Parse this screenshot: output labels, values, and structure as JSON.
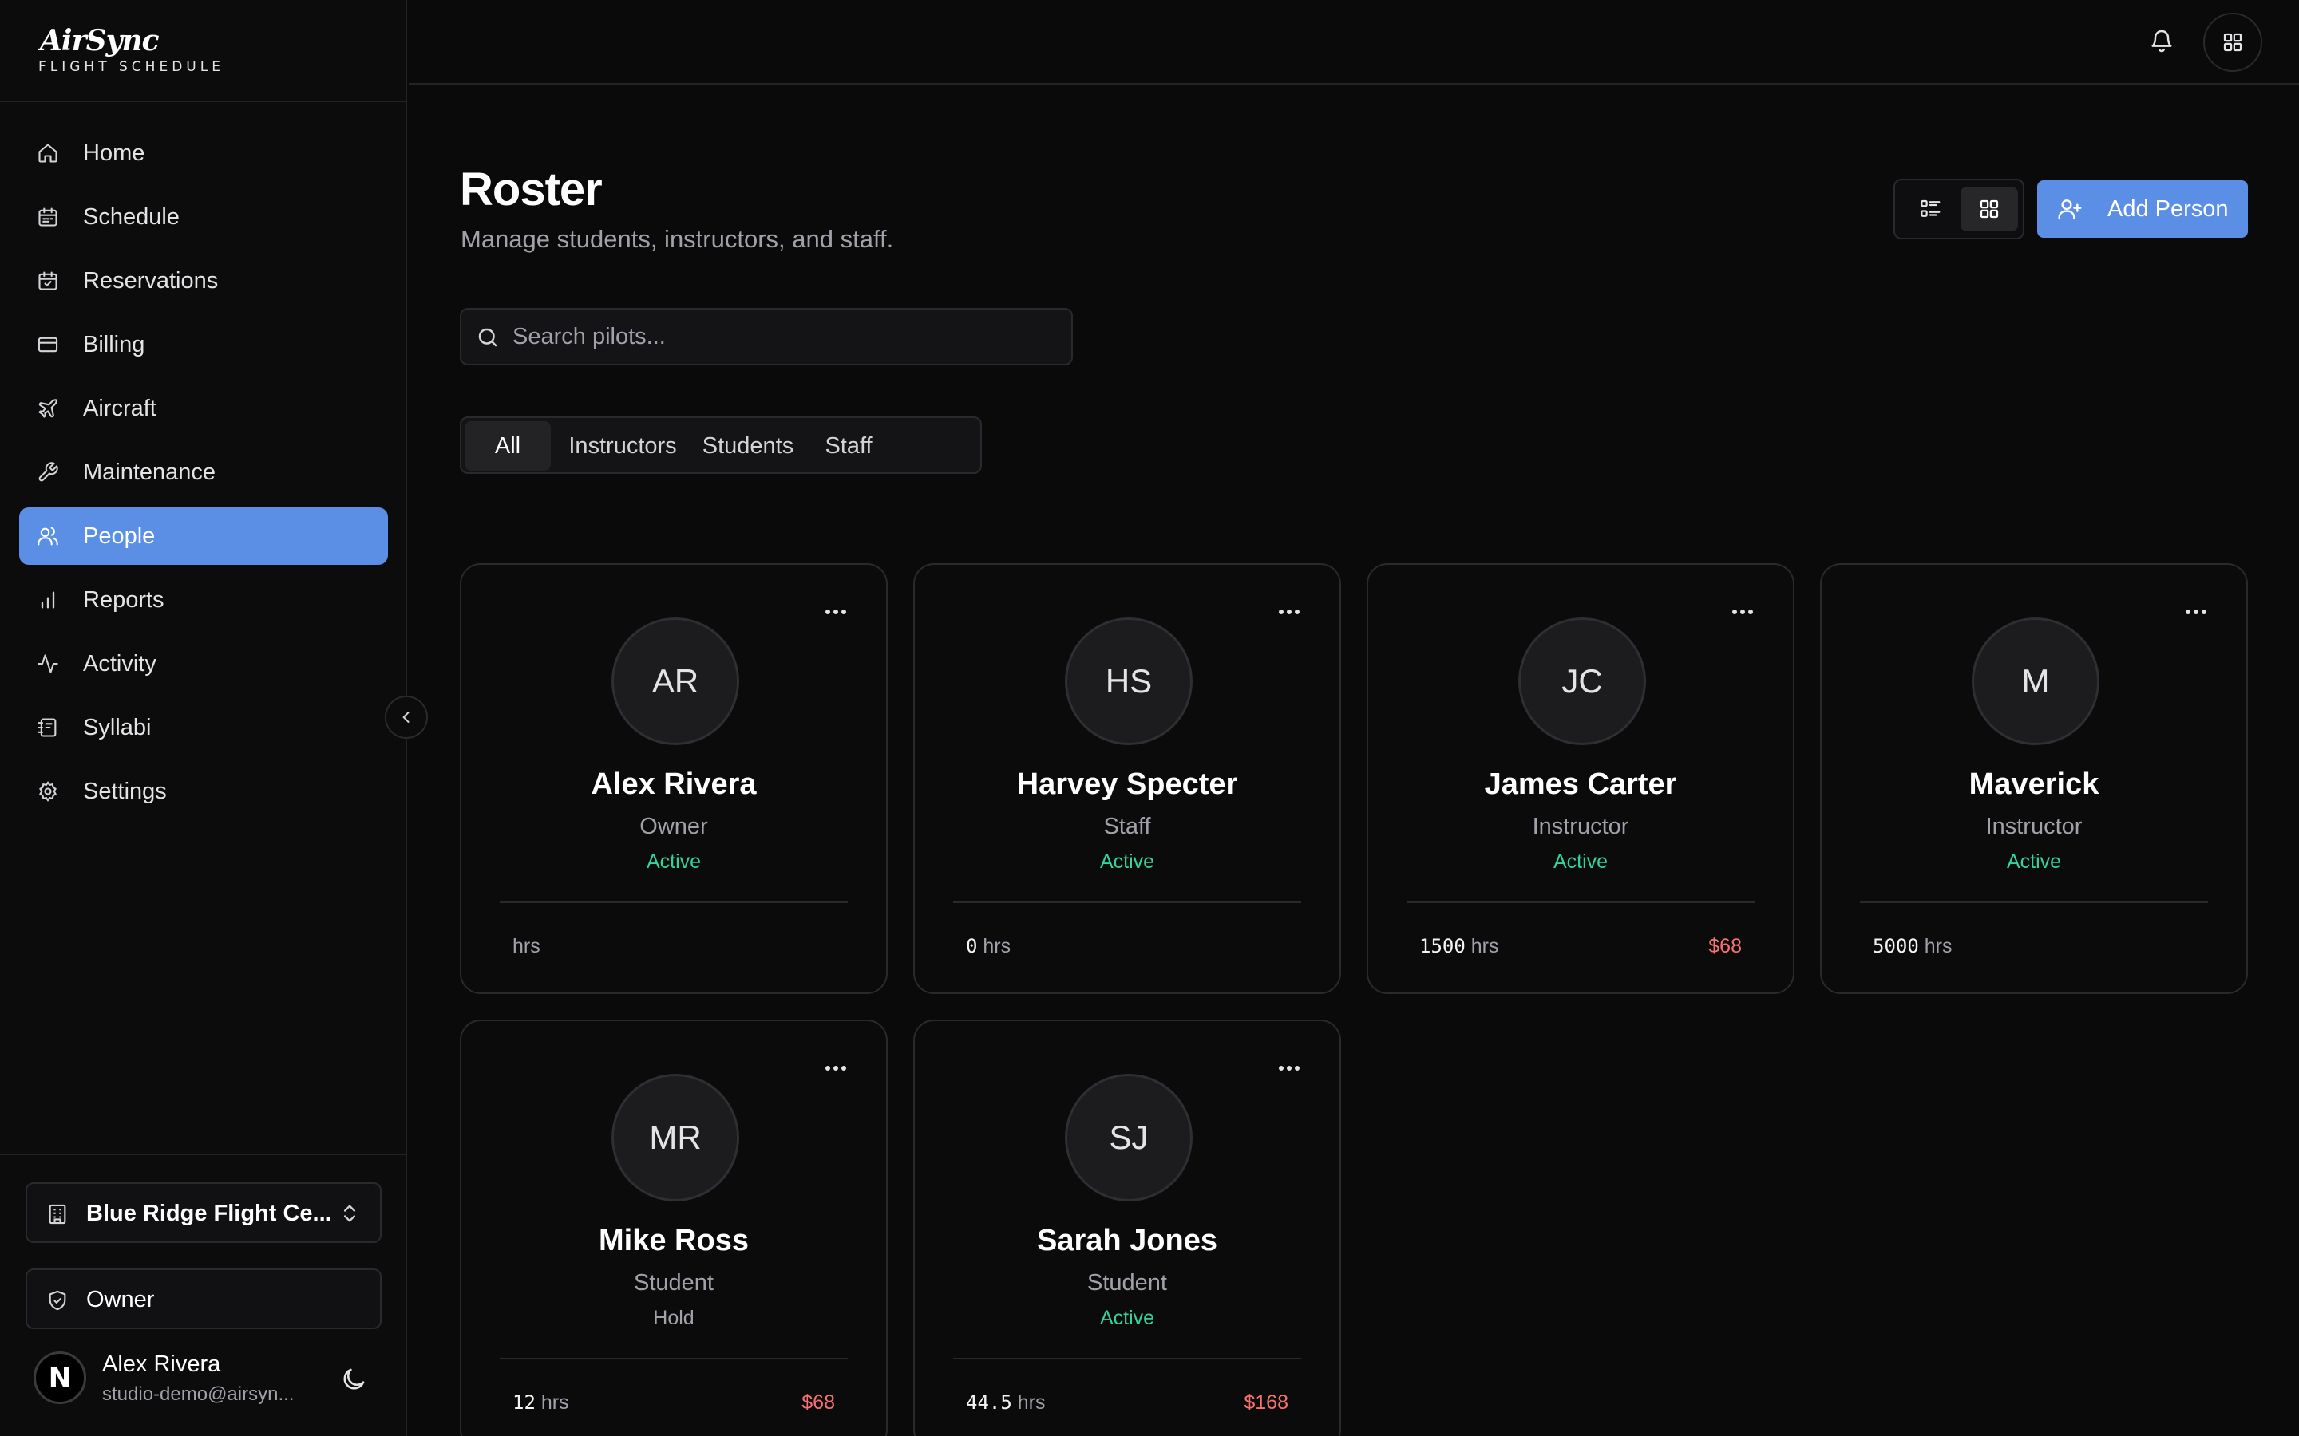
{
  "brand": {
    "name": "AirSync",
    "tagline": "FLIGHT SCHEDULE"
  },
  "sidebar": {
    "items": [
      {
        "label": "Home",
        "icon": "home-icon"
      },
      {
        "label": "Schedule",
        "icon": "calendar-icon"
      },
      {
        "label": "Reservations",
        "icon": "calendar-check-icon"
      },
      {
        "label": "Billing",
        "icon": "credit-card-icon"
      },
      {
        "label": "Aircraft",
        "icon": "plane-icon"
      },
      {
        "label": "Maintenance",
        "icon": "wrench-icon"
      },
      {
        "label": "People",
        "icon": "users-icon",
        "active": true
      },
      {
        "label": "Reports",
        "icon": "bar-chart-icon"
      },
      {
        "label": "Activity",
        "icon": "activity-icon"
      },
      {
        "label": "Syllabi",
        "icon": "notebook-icon"
      },
      {
        "label": "Settings",
        "icon": "gear-icon"
      }
    ],
    "org": "Blue Ridge Flight Ce...",
    "role": "Owner",
    "user": {
      "name": "Alex Rivera",
      "email": "studio-demo@airsyn...",
      "initial": "N"
    }
  },
  "colors": {
    "accent": "#5b8fe6",
    "active_status": "#34d399",
    "amount": "#f87171"
  },
  "page": {
    "title": "Roster",
    "subtitle": "Manage students, instructors, and staff.",
    "add_button": "Add Person",
    "search_placeholder": "Search pilots...",
    "tabs": [
      "All",
      "Instructors",
      "Students",
      "Staff"
    ],
    "selected_tab": "All",
    "view_mode": "grid"
  },
  "people": [
    {
      "initials": "AR",
      "name": "Alex Rivera",
      "role": "Owner",
      "status": "Active",
      "hours": "",
      "unit": "hrs",
      "amount": ""
    },
    {
      "initials": "HS",
      "name": "Harvey Specter",
      "role": "Staff",
      "status": "Active",
      "hours": "0",
      "unit": "hrs",
      "amount": ""
    },
    {
      "initials": "JC",
      "name": "James Carter",
      "role": "Instructor",
      "status": "Active",
      "hours": "1500",
      "unit": "hrs",
      "amount": "$68"
    },
    {
      "initials": "M",
      "name": "Maverick",
      "role": "Instructor",
      "status": "Active",
      "hours": "5000",
      "unit": "hrs",
      "amount": ""
    },
    {
      "initials": "MR",
      "name": "Mike Ross",
      "role": "Student",
      "status": "Hold",
      "hours": "12",
      "unit": "hrs",
      "amount": "$68"
    },
    {
      "initials": "SJ",
      "name": "Sarah Jones",
      "role": "Student",
      "status": "Active",
      "hours": "44.5",
      "unit": "hrs",
      "amount": "$168"
    }
  ]
}
